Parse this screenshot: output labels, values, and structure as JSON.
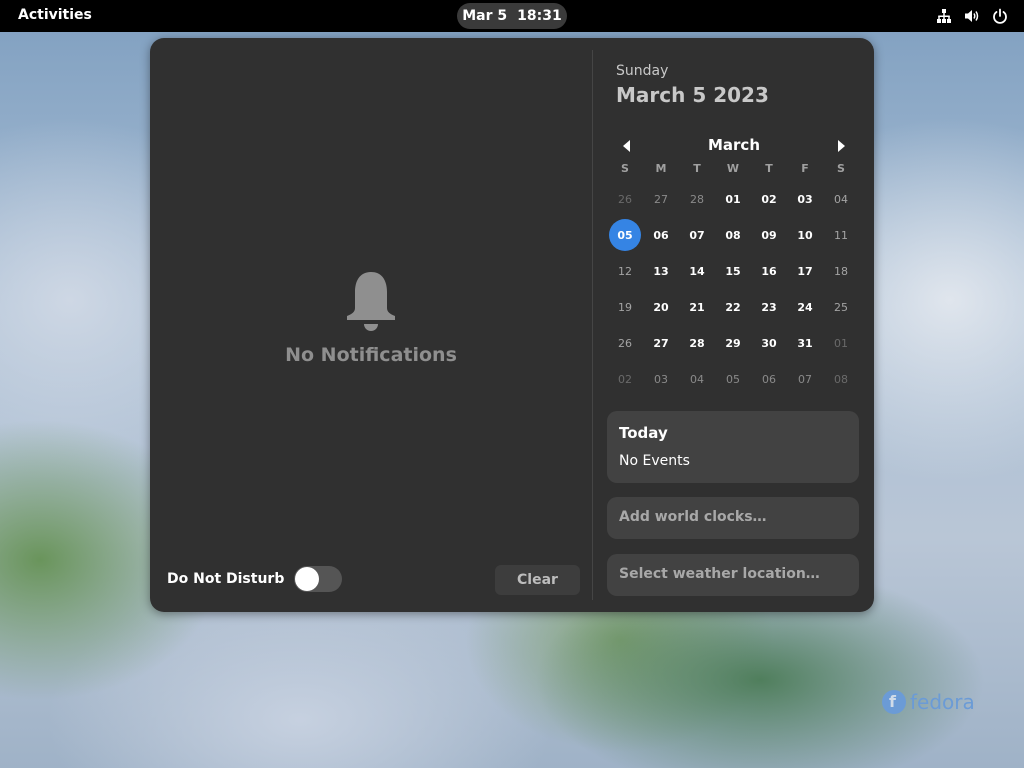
{
  "topbar": {
    "activities": "Activities",
    "date": "Mar 5",
    "time": "18:31"
  },
  "icons": {
    "network": "network-wired-icon",
    "volume": "volume-icon",
    "power": "power-icon",
    "bell": "bell-icon"
  },
  "notifications": {
    "empty_text": "No Notifications",
    "dnd_label": "Do Not Disturb",
    "dnd_enabled": false,
    "clear_label": "Clear"
  },
  "calendar": {
    "weekday": "Sunday",
    "full_date": "March 5 2023",
    "month": "March",
    "weekday_headers": [
      "S",
      "M",
      "T",
      "W",
      "T",
      "F",
      "S"
    ],
    "weeks": [
      [
        "26",
        "27",
        "28",
        "01",
        "02",
        "03",
        "04"
      ],
      [
        "05",
        "06",
        "07",
        "08",
        "09",
        "10",
        "11"
      ],
      [
        "12",
        "13",
        "14",
        "15",
        "16",
        "17",
        "18"
      ],
      [
        "19",
        "20",
        "21",
        "22",
        "23",
        "24",
        "25"
      ],
      [
        "26",
        "27",
        "28",
        "29",
        "30",
        "31",
        "01"
      ],
      [
        "02",
        "03",
        "04",
        "05",
        "06",
        "07",
        "08"
      ]
    ],
    "today": "05",
    "accent_color": "#3584e4"
  },
  "events": {
    "title": "Today",
    "empty_text": "No Events"
  },
  "world_clocks": {
    "label": "Add world clocks…"
  },
  "weather": {
    "label": "Select weather location…"
  },
  "branding": {
    "text": "fedora",
    "color": "#6b9bd6"
  }
}
